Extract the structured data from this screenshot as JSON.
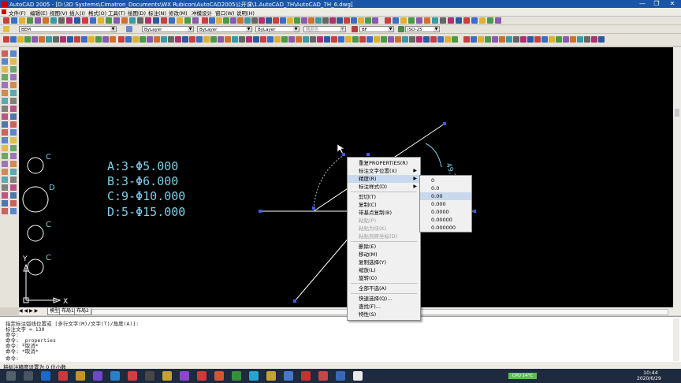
{
  "window": {
    "title": "AutoCAD 2005 - [D:\\3D Systems\\Cimatron_Documents\\WX Rubicon\\AutoCAD2005公开课\\1.AutoCAD_7H\\AutoCAD_7H_6.dwg]",
    "min": "—",
    "max": "❐",
    "close": "✕"
  },
  "menubar": [
    "文件(F)",
    "编辑(E)",
    "视图(V)",
    "插入(I)",
    "格式(O)",
    "工具(T)",
    "绘图(D)",
    "标注(N)",
    "修改(M)",
    "冲模设计",
    "窗口(W)",
    "说明(H)"
  ],
  "toolbar2": {
    "layer": "BEM",
    "color": "ByLayer",
    "linetype": "ByLayer",
    "lineweight": "ByLayer",
    "plotstyle": "随颜色",
    "style": "BF",
    "dimstyle": "ISO-25"
  },
  "drawing": {
    "labels": [
      "A:3-Φ5.000",
      "B:3-Φ6.000",
      "C:9-Φ10.000",
      "D:5-Φ15.000"
    ],
    "hole_tags": [
      "C",
      "D",
      "C",
      "C"
    ],
    "ucs_x": "X",
    "ucs_y": "Y",
    "angle_dim": "49.7°"
  },
  "layout_tabs": [
    "模型",
    "布局1",
    "布局2"
  ],
  "context_menu": {
    "items": [
      {
        "label": "重复PROPERTIES(R)",
        "enabled": true,
        "submenu": false
      },
      {
        "label": "标注文字位置(X)",
        "enabled": true,
        "submenu": true
      },
      {
        "label": "精度(R)",
        "enabled": true,
        "submenu": true,
        "highlighted": true
      },
      {
        "label": "标注样式(D)",
        "enabled": true,
        "submenu": true
      },
      {
        "label": "剪切(T)",
        "enabled": true,
        "submenu": false
      },
      {
        "label": "复制(C)",
        "enabled": true,
        "submenu": false
      },
      {
        "label": "带基点复制(B)",
        "enabled": true,
        "submenu": false
      },
      {
        "label": "粘贴(P)",
        "enabled": false,
        "submenu": false
      },
      {
        "label": "粘贴为块(K)",
        "enabled": false,
        "submenu": false
      },
      {
        "label": "粘贴到原坐标(D)",
        "enabled": false,
        "submenu": false
      },
      {
        "label": "删除(E)",
        "enabled": true,
        "submenu": false
      },
      {
        "label": "移动(M)",
        "enabled": true,
        "submenu": false
      },
      {
        "label": "复制选择(Y)",
        "enabled": true,
        "submenu": false
      },
      {
        "label": "缩放(L)",
        "enabled": true,
        "submenu": false
      },
      {
        "label": "旋转(O)",
        "enabled": true,
        "submenu": false
      },
      {
        "label": "全部不选(A)",
        "enabled": true,
        "submenu": false
      },
      {
        "label": "快速选择(Q)...",
        "enabled": true,
        "submenu": false
      },
      {
        "label": "查找(F)...",
        "enabled": true,
        "submenu": false
      },
      {
        "label": "特性(S)",
        "enabled": true,
        "submenu": false
      }
    ]
  },
  "precision_submenu": {
    "options": [
      "0",
      "0.0",
      "0.00",
      "0.000",
      "0.0000",
      "0.00000",
      "0.000000"
    ],
    "selected": "0.00"
  },
  "command_history": [
    "指定标注弧线位置或 [多行文字(M)/文字(T)/角度(A)]:",
    "标注文字 = 130",
    "命令:",
    "命令: _properties",
    "命令: *取消*",
    "命令: *取消*",
    "命令:"
  ],
  "status_text": "将标注精度设置为 0 位小数",
  "taskbar": {
    "cpu": "CPU 14°C",
    "time": "10:44",
    "date": "2020/6/29"
  },
  "colors": {
    "dimension": "#7ecfe6",
    "grip": "#3a5cff",
    "highlight": "#c8d9ee",
    "title": "#1a56a8"
  }
}
